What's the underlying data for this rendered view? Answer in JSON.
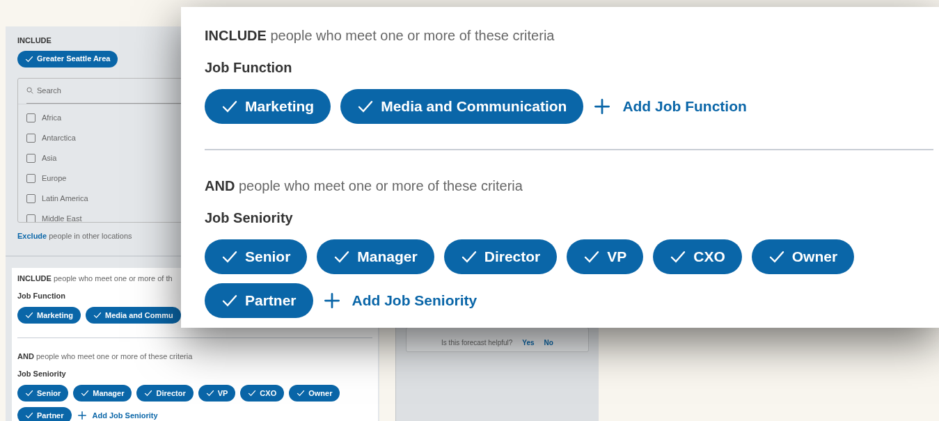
{
  "background": {
    "location": {
      "heading": "INCLUDE",
      "chips": [
        {
          "label": "Greater Seattle Area",
          "checked": true
        }
      ],
      "search": {
        "placeholder": "Search"
      },
      "options": [
        {
          "label": "Africa",
          "checked": false
        },
        {
          "label": "Antarctica",
          "checked": false
        },
        {
          "label": "Asia",
          "checked": false
        },
        {
          "label": "Europe",
          "checked": false
        },
        {
          "label": "Latin America",
          "checked": false
        },
        {
          "label": "Middle East",
          "checked": false
        }
      ],
      "exclude_link": "Exclude",
      "exclude_text": "people in other locations"
    },
    "criteria": [
      {
        "lead": "INCLUDE",
        "text": "people who meet one or more of th",
        "title": "Job Function",
        "chips": [
          {
            "label": "Marketing",
            "checked": true
          },
          {
            "label": "Media and Commu",
            "checked": true
          }
        ]
      },
      {
        "lead": "AND",
        "text": "people who meet one or more of these criteria",
        "title": "Job Seniority",
        "chips": [
          {
            "label": "Senior",
            "checked": true
          },
          {
            "label": "Manager",
            "checked": true
          },
          {
            "label": "Director",
            "checked": true
          },
          {
            "label": "VP",
            "checked": true
          },
          {
            "label": "CXO",
            "checked": true
          },
          {
            "label": "Owner",
            "checked": true
          },
          {
            "label": "Partner",
            "checked": true
          }
        ],
        "add": "Add Job Seniority"
      }
    ],
    "forecast": {
      "question": "Is this forecast helpful?",
      "yes": "Yes",
      "no": "No"
    }
  },
  "zoom": {
    "criteria": [
      {
        "lead": "INCLUDE",
        "text": "people who meet one or more of these criteria",
        "title": "Job Function",
        "chips": [
          {
            "label": "Marketing",
            "checked": true
          },
          {
            "label": "Media and Communication",
            "checked": true
          }
        ],
        "add": "Add Job Function"
      },
      {
        "lead": "AND",
        "text": "people who meet one or more of these criteria",
        "title": "Job Seniority",
        "chips": [
          {
            "label": "Senior",
            "checked": true
          },
          {
            "label": "Manager",
            "checked": true
          },
          {
            "label": "Director",
            "checked": true
          },
          {
            "label": "VP",
            "checked": true
          },
          {
            "label": "CXO",
            "checked": true
          },
          {
            "label": "Owner",
            "checked": true
          },
          {
            "label": "Partner",
            "checked": true
          }
        ],
        "add": "Add Job Seniority"
      }
    ]
  }
}
